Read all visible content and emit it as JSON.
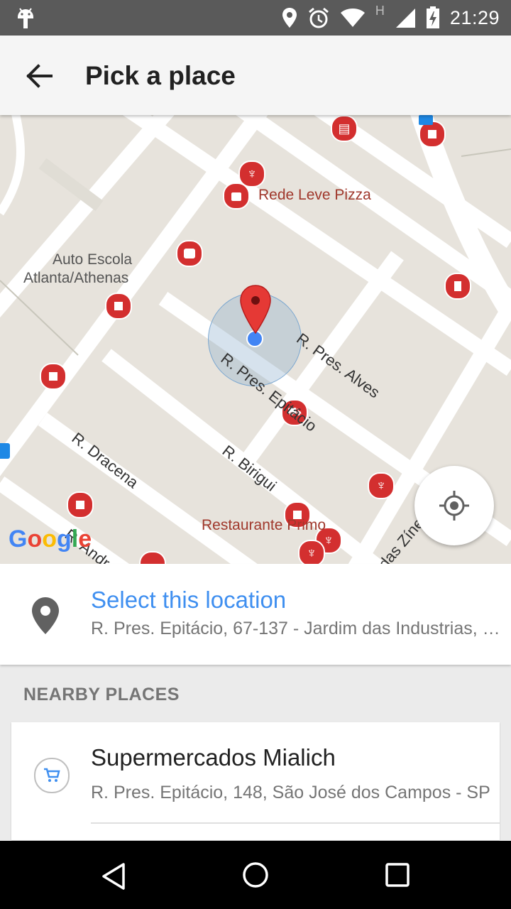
{
  "status_bar": {
    "time": "21:29",
    "network_type": "H",
    "icons": [
      "android-icon",
      "location-icon",
      "alarm-icon",
      "wifi-icon",
      "signal-icon",
      "battery-charging-icon"
    ]
  },
  "app_bar": {
    "title": "Pick a place",
    "back_icon": "arrow-back-icon"
  },
  "map": {
    "labels": {
      "poi_rede_leve": "Rede Leve Pizza",
      "poi_auto_escola_1": "Auto Escola",
      "poi_auto_escola_2": "Atlanta/Athenas",
      "street_alves": "R. Pres. Alves",
      "street_epitacio": "R. Pres. Epitácio",
      "street_dracena": "R. Dracena",
      "street_birigui": "R. Birigui",
      "poi_restaurante": "Restaurante Primo",
      "street_zineas": "das Zíneas",
      "street_andr": "R. Andr"
    },
    "google_logo": "Google",
    "colors": {
      "land": "#e7e3dc",
      "road": "#ffffff",
      "poi": "#d32f2f",
      "pin": "#e53935",
      "my_location": "#4285f4"
    }
  },
  "select_location": {
    "title": "Select this location",
    "address": "R. Pres. Epitácio, 67-137 - Jardim das Industrias, São José dos Campos - SP"
  },
  "nearby": {
    "label": "NEARBY PLACES",
    "places": [
      {
        "name": "Supermercados Mialich",
        "address": "R. Pres. Epitácio, 148, São José dos Campos - SP",
        "icon": "shopping-cart-icon"
      }
    ]
  },
  "nav_bar": {
    "buttons": [
      "back-triangle-icon",
      "home-circle-icon",
      "recents-square-icon"
    ]
  },
  "accent_color": "#3f8ff0"
}
